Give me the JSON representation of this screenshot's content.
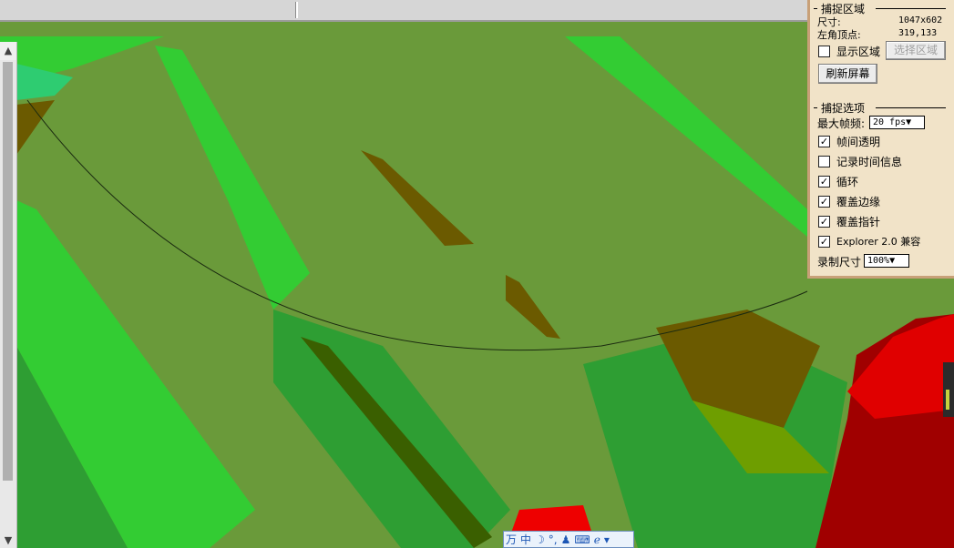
{
  "capture_area": {
    "title": "捕捉区域",
    "size_label": "尺寸:",
    "size_value": "1047x602",
    "corner_label": "左角顶点:",
    "corner_value": "319,133",
    "show_area_label": "显示区域",
    "show_area_checked": false,
    "select_area_button": "选择区域",
    "refresh_button": "刷新屏幕"
  },
  "capture_options": {
    "title": "捕捉选项",
    "max_fps_label": "最大帧频:",
    "max_fps_value": "20 fps▼",
    "frame_transparency_label": "帧间透明",
    "frame_transparency_checked": true,
    "record_time_label": "记录时间信息",
    "record_time_checked": false,
    "loop_label": "循环",
    "loop_checked": true,
    "cover_edge_label": "覆盖边缘",
    "cover_edge_checked": true,
    "cover_pointer_label": "覆盖指针",
    "cover_pointer_checked": true,
    "explorer_label": "Explorer 2.0 兼容",
    "explorer_checked": true,
    "record_size_label": "录制尺寸",
    "record_size_value": "100%▼"
  },
  "ime_bar": {
    "items": [
      "万",
      "中",
      "☽",
      "°,",
      "♟",
      "⌨",
      "ℯ",
      "▾"
    ]
  },
  "scrollbar": {
    "up_arrow": "▲",
    "down_arrow": "▼"
  },
  "colors": {
    "ground": "#6a9a3a",
    "bright_green": "#33cc33",
    "mid_green": "#2e9e33",
    "dark_brown": "#6b5a00",
    "red": "#e00000",
    "dark_red": "#a00000",
    "panel_bg": "#f1e3c8",
    "panel_border": "#c8a078"
  }
}
